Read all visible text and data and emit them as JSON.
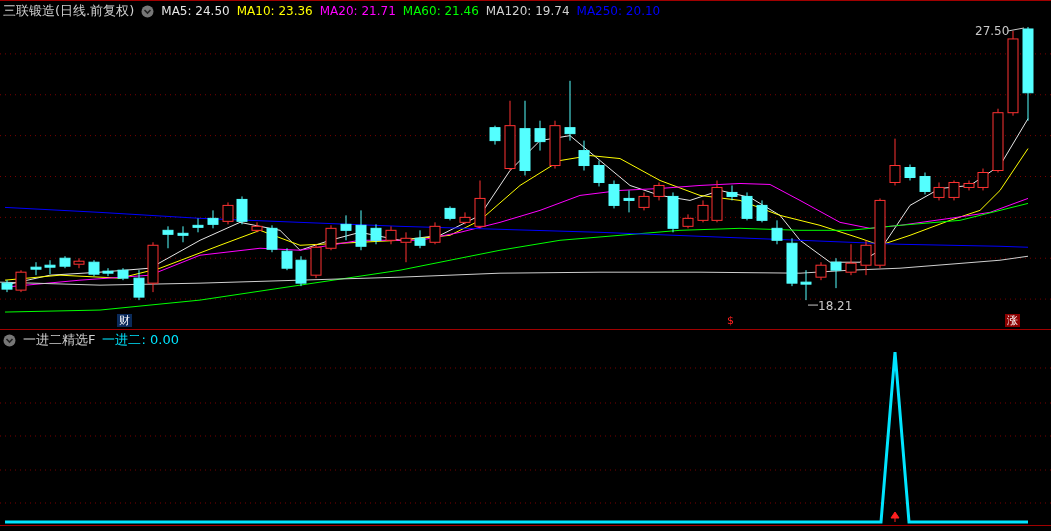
{
  "main_chart": {
    "title": "三联锻造(日线.前复权)",
    "legend": [
      {
        "label": "MA5: 24.50",
        "color": "#e6e6e6"
      },
      {
        "label": "MA10: 23.36",
        "color": "#ffff00"
      },
      {
        "label": "MA20: 21.71",
        "color": "#ff00ff"
      },
      {
        "label": "MA60: 21.46",
        "color": "#00ff00"
      },
      {
        "label": "MA120: 19.74",
        "color": "#d0d0d0"
      },
      {
        "label": "MA250: 20.10",
        "color": "#0000ff"
      }
    ],
    "high_label": "27.50",
    "low_label": "18.21",
    "markers": [
      {
        "text": "财",
        "kind": "finance"
      },
      {
        "text": "$",
        "kind": "dollar"
      },
      {
        "text": "涨",
        "kind": "limit"
      }
    ]
  },
  "indicator": {
    "title": "一进二精选F",
    "value_label": "一进二: 0.00"
  }
}
